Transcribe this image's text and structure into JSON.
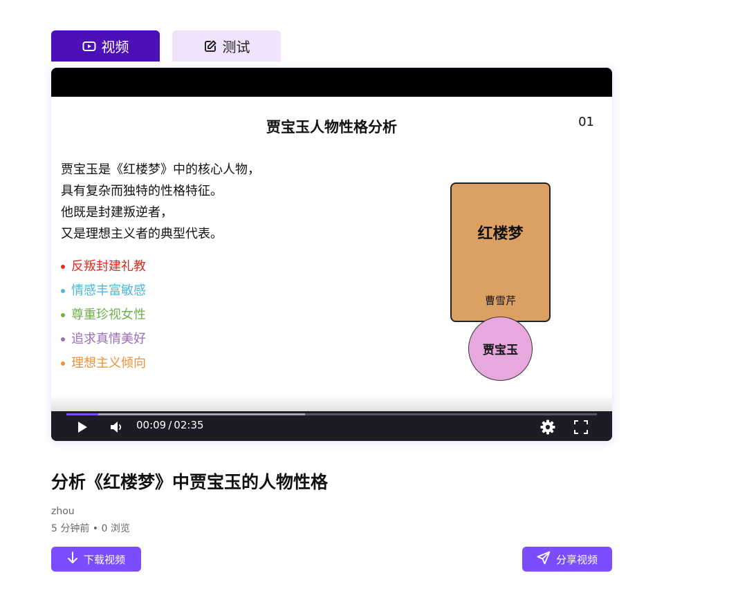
{
  "tabs": [
    {
      "label": "视频",
      "icon": "video-icon",
      "active": true
    },
    {
      "label": "测试",
      "icon": "edit-icon",
      "active": false
    }
  ],
  "slide": {
    "title": "贾宝玉人物性格分析",
    "number": "01",
    "paragraph": [
      "贾宝玉是《红楼梦》中的核心人物，",
      "具有复杂而独特的性格特征。",
      "他既是封建叛逆者，",
      "又是理想主义者的典型代表。"
    ],
    "bullets": [
      {
        "text": "反叛封建礼教",
        "color": "#e8281e"
      },
      {
        "text": "情感丰富敏感",
        "color": "#4fb6d8"
      },
      {
        "text": "尊重珍视女性",
        "color": "#6fb04c"
      },
      {
        "text": "追求真情美好",
        "color": "#9b6cba"
      },
      {
        "text": "理想主义倾向",
        "color": "#f0913a"
      }
    ],
    "book_title": "红楼梦",
    "book_author": "曹雪芹",
    "character": "贾宝玉"
  },
  "player": {
    "current_time": "00:09",
    "separator": "/",
    "duration": "02:35",
    "played_fraction": 0.06,
    "buffered_fraction": 0.45
  },
  "video": {
    "title": "分析《红楼梦》中贾宝玉的人物性格",
    "author": "zhou",
    "meta": "5 分钟前 • 0 浏览"
  },
  "actions": {
    "download_label": "下载视频",
    "share_label": "分享视频"
  },
  "colors": {
    "tab_active": "#4c10b8",
    "tab_inactive": "#efe4fb",
    "accent": "#7b4dff",
    "book": "#dca162",
    "character_circle": "#e7a8de"
  }
}
